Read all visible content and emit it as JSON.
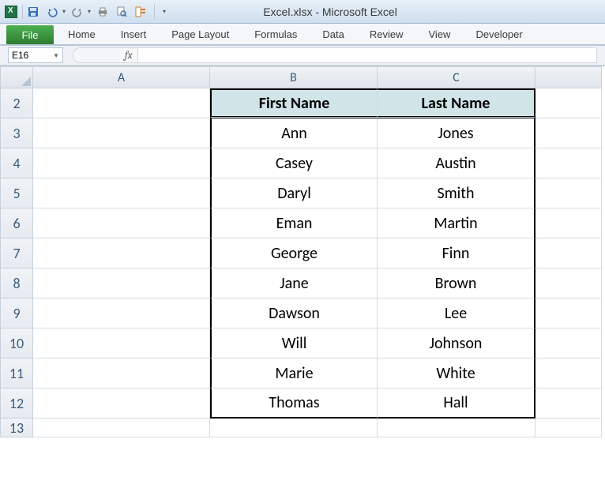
{
  "titlebar": {
    "title": "Excel.xlsx - Microsoft Excel"
  },
  "ribbon": {
    "file": "File",
    "tabs": [
      "Home",
      "Insert",
      "Page Layout",
      "Formulas",
      "Data",
      "Review",
      "View",
      "Developer"
    ]
  },
  "formula_bar": {
    "namebox": "E16",
    "fx": "fx",
    "formula": ""
  },
  "columns": [
    "A",
    "B",
    "C"
  ],
  "row_numbers": [
    2,
    3,
    4,
    5,
    6,
    7,
    8,
    9,
    10,
    11,
    12,
    13
  ],
  "table": {
    "headers": {
      "b": "First Name",
      "c": "Last Name"
    },
    "rows": [
      {
        "b": "Ann",
        "c": "Jones"
      },
      {
        "b": "Casey",
        "c": "Austin"
      },
      {
        "b": "Daryl",
        "c": "Smith"
      },
      {
        "b": "Eman",
        "c": "Martin"
      },
      {
        "b": "George",
        "c": "Finn"
      },
      {
        "b": "Jane",
        "c": "Brown"
      },
      {
        "b": "Dawson",
        "c": "Lee"
      },
      {
        "b": "Will",
        "c": "Johnson"
      },
      {
        "b": "Marie",
        "c": "White"
      },
      {
        "b": "Thomas",
        "c": "Hall"
      }
    ]
  }
}
